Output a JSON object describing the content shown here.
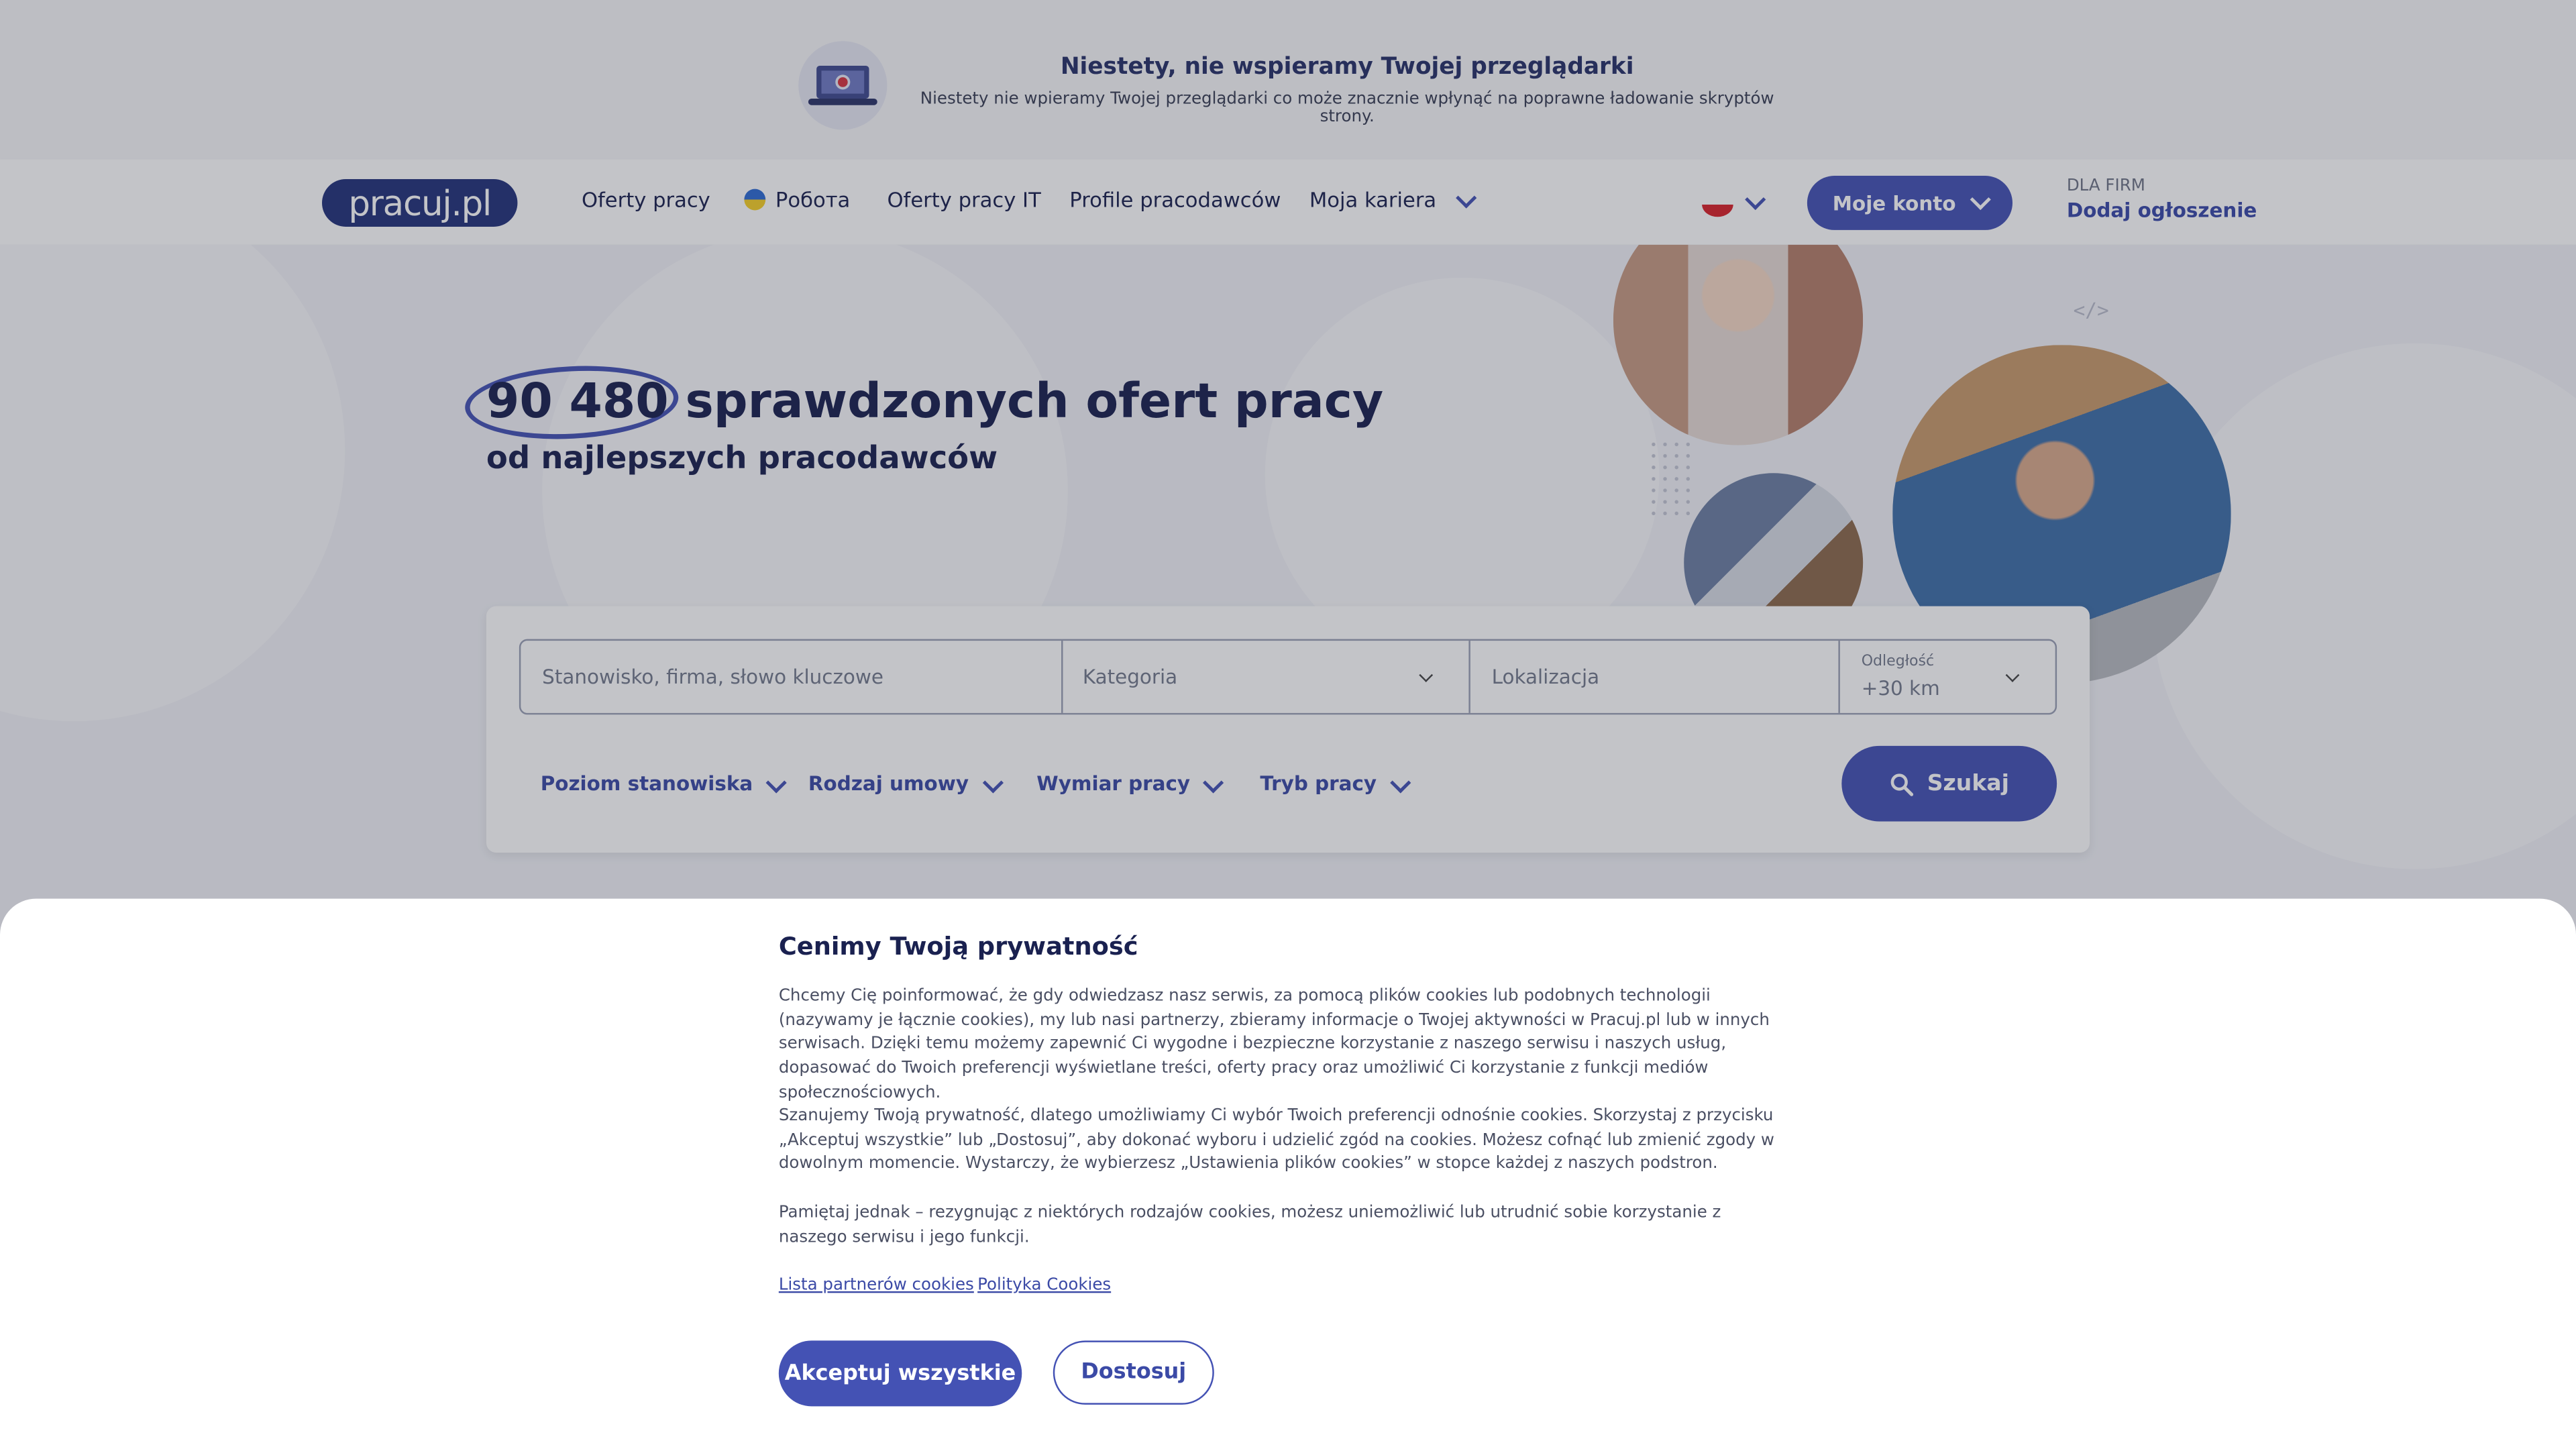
{
  "browser_banner": {
    "title": "Niestety, nie wspieramy Twojej przeglądarki",
    "text": "Niestety nie wpieramy Twojej przeglądarki co może znacznie wpłynąć na poprawne ładowanie skryptów strony.",
    "icon": "laptop-warning-icon"
  },
  "nav": {
    "logo": "pracuj.pl",
    "items": [
      "Oferty pracy",
      "Робота",
      "Oferty pracy IT",
      "Profile pracodawców",
      "Moja kariera"
    ],
    "account_label": "Moje konto",
    "for_firms_small": "DLA FIRM",
    "for_firms_link": "Dodaj ogłoszenie"
  },
  "hero": {
    "count": "90 480",
    "headline_rest": "sprawdzonych ofert pracy",
    "subheadline": "od najlepszych pracodawców",
    "code_mark": "</>"
  },
  "search": {
    "keyword_placeholder": "Stanowisko, firma, słowo kluczowe",
    "category_placeholder": "Kategoria",
    "location_placeholder": "Lokalizacja",
    "distance_label": "Odległość",
    "distance_value": "+30 km",
    "filters": [
      "Poziom stanowiska",
      "Rodzaj umowy",
      "Wymiar pracy",
      "Tryb pracy"
    ],
    "search_button": "Szukaj"
  },
  "cookie": {
    "title": "Cenimy Twoją prywatność",
    "p1": "Chcemy Cię poinformować, że gdy odwiedzasz nasz serwis, za pomocą plików cookies lub podobnych technologii (nazywamy je łącznie cookies), my lub nasi partnerzy, zbieramy informacje o Twojej aktywności w Pracuj.pl lub w innych serwisach. Dzięki temu możemy zapewnić Ci wygodne i bezpieczne korzystanie z naszego serwisu i naszych usług, dopasować do Twoich preferencji wyświetlane treści, oferty pracy oraz umożliwić Ci korzystanie z funkcji mediów społecznościowych.",
    "p2": "Szanujemy Twoją prywatność, dlatego umożliwiamy Ci wybór Twoich preferencji odnośnie cookies. Skorzystaj z przycisku „Akceptuj wszystkie” lub „Dostosuj”, aby dokonać wyboru i udzielić zgód na cookies. Możesz cofnąć lub zmienić zgody w dowolnym momencie. Wystarczy, że wybierzesz „Ustawienia plików cookies” w stopce każdej z naszych podstron.",
    "p3": "Pamiętaj jednak – rezygnując z niektórych rodzajów cookies, możesz uniemożliwić lub utrudnić sobie korzystanie z naszego serwisu i jego funkcji.",
    "link_partners": "Lista partnerów cookies",
    "link_policy": "Polityka Cookies",
    "accept": "Akceptuj wszystkie",
    "customize": "Dostosuj"
  },
  "colors": {
    "accent": "#4452b4",
    "text_dark": "#1a2150"
  }
}
